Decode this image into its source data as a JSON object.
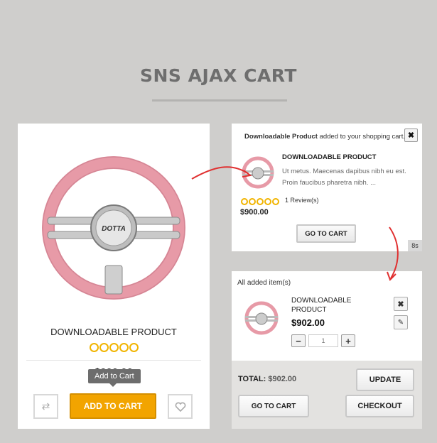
{
  "header": {
    "title": "SNS AJAX CART"
  },
  "product_card": {
    "name": "DOWNLOADABLE PRODUCT",
    "price": "$900.00",
    "tooltip": "Add to Cart",
    "add_to_cart_label": "ADD TO CART",
    "rating_stars": 5,
    "compare_icon": "compare-icon",
    "wishlist_icon": "heart-icon"
  },
  "popup": {
    "message_product": "Downloadable Product",
    "message_rest": " added to your shopping cart.",
    "close_label": "✖",
    "product_name": "DOWNLOADABLE PRODUCT",
    "description": "Ut metus. Maecenas dapibus nibh eu est. Proin faucibus pharetra nibh. ...",
    "review_text": "1 Review(s)",
    "price": "$900.00",
    "goto_cart_label": "GO TO CART",
    "timer": "8s"
  },
  "mini_cart": {
    "header": "All added item(s)",
    "item": {
      "name": "DOWNLOADABLE PRODUCT",
      "price": "$902.00",
      "qty_placeholder": "1",
      "minus_label": "−",
      "plus_label": "+",
      "delete_label": "✖",
      "edit_label": "✎"
    },
    "total_label": "TOTAL:",
    "total_value": "$902.00",
    "update_label": "UPDATE",
    "goto_cart_label": "GO TO CART",
    "checkout_label": "CHECKOUT"
  },
  "colors": {
    "background": "#cfcecc",
    "accent_button": "#f2a400",
    "star": "#f1b400",
    "arrow": "#e03030",
    "wheel_pink": "#e79aa7"
  }
}
